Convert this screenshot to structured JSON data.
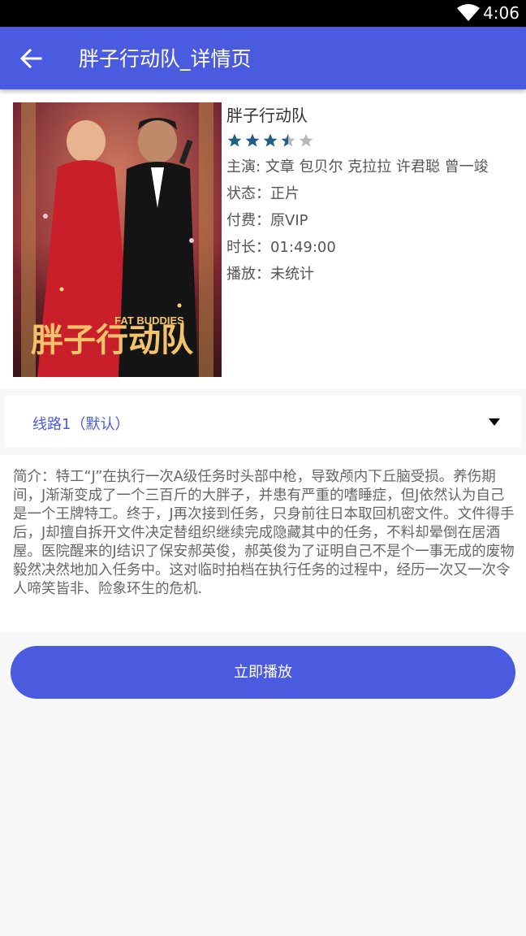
{
  "status_bar": {
    "time": "4:06",
    "wifi_icon": "wifi-icon"
  },
  "app_bar": {
    "title": "胖子行动队_详情页",
    "back_icon": "arrow-left-icon"
  },
  "movie": {
    "title": "胖子行动队",
    "poster": {
      "title_art": "胖子行动队",
      "subtitle_art": "FAT BUDDIES"
    },
    "rating": {
      "value": 3.5,
      "max": 5,
      "color": "#1f5f86"
    },
    "cast": "主演: 文章 包贝尔 克拉拉 许君聪 曾一竣",
    "status": "状态：正片",
    "fee": "付费：原VIP",
    "duration": "时长：01:49:00",
    "plays": "播放：未统计"
  },
  "line_selector": {
    "selected": "线路1（默认）",
    "icon": "triangle-down-icon"
  },
  "description": "简介：特工“J”在执行一次A级任务时头部中枪，导致颅内下丘脑受损。养伤期间，J渐渐变成了一个三百斤的大胖子，并患有严重的嗜睡症，但J依然认为自己是一个王牌特工。终于，J再次接到任务，只身前往日本取回机密文件。文件得手后，J却擅自拆开文件决定替组织继续完成隐藏其中的任务，不料却晕倒在居酒屋。医院醒来的J结识了保安郝英俊，郝英俊为了证明自己不是个一事无成的废物毅然决然地加入任务中。这对临时拍档在执行任务的过程中，经历一次又一次令人啼笑皆非、险象环生的危机.",
  "play_button": {
    "label": "立即播放"
  },
  "colors": {
    "accent": "#4a5be0",
    "status_bar": "#000000"
  }
}
